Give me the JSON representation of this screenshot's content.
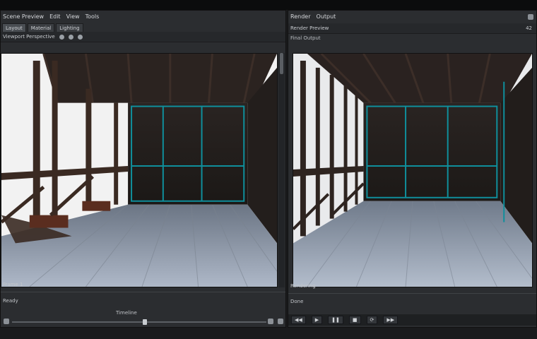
{
  "app": {
    "left_title": "Scene Preview",
    "left_menu": [
      "Edit",
      "View",
      "Tools"
    ],
    "right_title": "Render",
    "right_menu": [
      "Output"
    ]
  },
  "left": {
    "tabs": [
      "Layout",
      "Material",
      "Lighting"
    ],
    "toolbar": "Viewport Perspective",
    "statusline_1": "Frame 1",
    "statusline_2": "Ready",
    "timeline_label": "Timeline"
  },
  "right": {
    "toolbar": "Render Preview",
    "subbar": "Final Output",
    "counter": "42",
    "statusline_1": "Rendering",
    "statusline_2": "Done"
  },
  "colors": {
    "panel_bg": "#2b2d30",
    "viewport_wood": "#8f99a8",
    "teal_frame": "#0f8f9c"
  }
}
